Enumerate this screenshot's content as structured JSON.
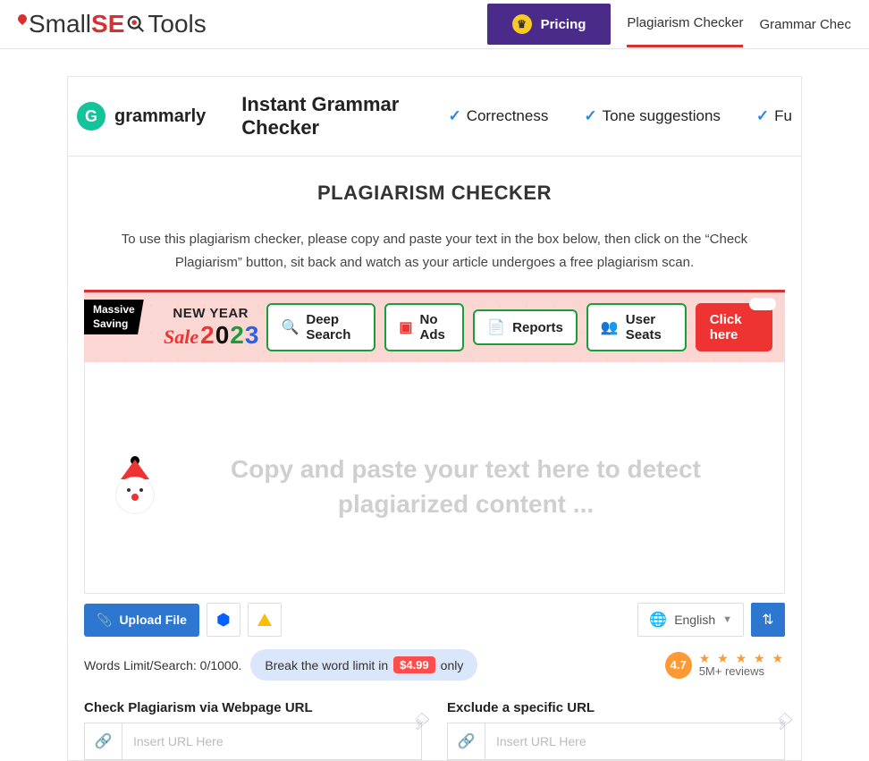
{
  "header": {
    "logo": {
      "part1": "Small",
      "part2": "SE",
      "part3": "Tools"
    },
    "pricing_label": "Pricing",
    "nav": {
      "plagiarism": "Plagiarism Checker",
      "grammar": "Grammar Chec"
    }
  },
  "grammarly": {
    "brand": "grammarly",
    "title": "Instant Grammar Checker",
    "features": {
      "f1": "Correctness",
      "f2": "Tone suggestions",
      "f3": "Fu"
    }
  },
  "page": {
    "title": "PLAGIARISM CHECKER",
    "intro": "To use this plagiarism checker, please copy and paste your text in the box below, then click on the “Check Plagiarism” button, sit back and watch as your article undergoes a free plagiarism scan."
  },
  "promo": {
    "badge_l1": "Massive",
    "badge_l2": "Saving",
    "newyear": "NEW YEAR",
    "sale": "Sale",
    "year": "2023",
    "pills": {
      "deep": "Deep Search",
      "noads": "No Ads",
      "reports": "Reports",
      "seats": "User Seats"
    },
    "cta": "Click here"
  },
  "editor": {
    "placeholder": "Copy and paste your text here to detect plagiarized content ..."
  },
  "toolbar": {
    "upload": "Upload File",
    "language": "English"
  },
  "limit": {
    "label": "Words Limit/Search: 0/1000.",
    "break_prefix": "Break the word limit in",
    "price": "$4.99",
    "break_suffix": "only"
  },
  "rating": {
    "value": "4.7",
    "stars": "★ ★ ★ ★ ★",
    "reviews": "5M+ reviews"
  },
  "urls": {
    "check": {
      "label": "Check Plagiarism via Webpage URL",
      "placeholder": "Insert URL Here"
    },
    "exclude": {
      "label": "Exclude a specific URL",
      "placeholder": "Insert URL Here"
    }
  }
}
